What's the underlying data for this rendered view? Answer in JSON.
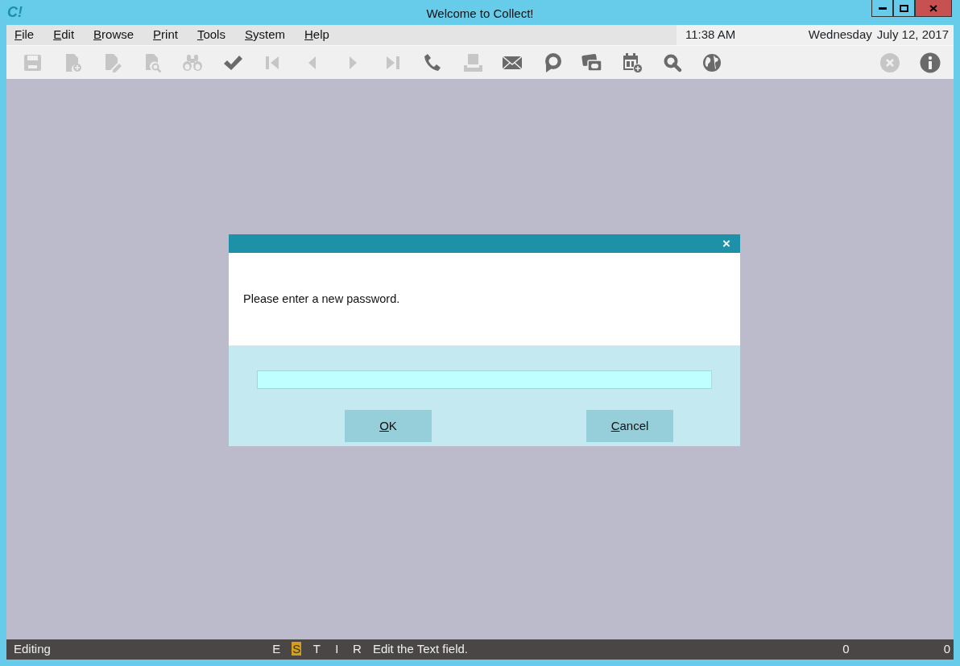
{
  "window": {
    "title": "Welcome to Collect!",
    "logo": "C!"
  },
  "menu": [
    {
      "label": "File",
      "mnemonic": true
    },
    {
      "label": "Edit",
      "mnemonic": true
    },
    {
      "label": "Browse",
      "mnemonic": true
    },
    {
      "label": "Print",
      "mnemonic": true
    },
    {
      "label": "Tools",
      "mnemonic": true
    },
    {
      "label": "System",
      "mnemonic": true
    },
    {
      "label": "Help",
      "mnemonic": true
    }
  ],
  "clock": {
    "time": "11:38 AM",
    "weekday": "Wednesday",
    "date": "July 12, 2017"
  },
  "toolbar": {
    "left": [
      {
        "kind": "save",
        "disabled": true
      },
      {
        "kind": "doc-add",
        "disabled": true
      },
      {
        "kind": "doc-edit",
        "disabled": true
      },
      {
        "kind": "doc-search",
        "disabled": true
      },
      {
        "kind": "binoculars",
        "disabled": true
      },
      {
        "kind": "check",
        "disabled": false
      },
      {
        "kind": "first",
        "disabled": true
      },
      {
        "kind": "prev",
        "disabled": true
      },
      {
        "kind": "next",
        "disabled": true
      },
      {
        "kind": "last",
        "disabled": true
      },
      {
        "kind": "phone",
        "disabled": false
      },
      {
        "kind": "tray",
        "disabled": true
      },
      {
        "kind": "mail",
        "disabled": false
      },
      {
        "kind": "chat",
        "disabled": false
      },
      {
        "kind": "card",
        "disabled": false
      },
      {
        "kind": "calendar",
        "disabled": false
      },
      {
        "kind": "search",
        "disabled": false
      },
      {
        "kind": "globe",
        "disabled": false
      }
    ],
    "right": [
      {
        "kind": "cancel",
        "disabled": true
      },
      {
        "kind": "info",
        "disabled": false
      }
    ]
  },
  "dialog": {
    "message": "Please enter a new password.",
    "close": "×",
    "buttons": [
      {
        "label": "OK",
        "mnemonic": true
      },
      {
        "label": "Cancel",
        "mnemonic": true
      }
    ]
  },
  "status_bar": {
    "mode": "Editing",
    "flags": [
      {
        "label": "E",
        "selected": false
      },
      {
        "label": "S",
        "selected": true
      },
      {
        "label": "T",
        "selected": false
      },
      {
        "label": "I",
        "selected": false
      },
      {
        "label": "R",
        "selected": false
      }
    ],
    "hint": "Edit the Text field.",
    "count_1": "0",
    "count_2": "0"
  }
}
